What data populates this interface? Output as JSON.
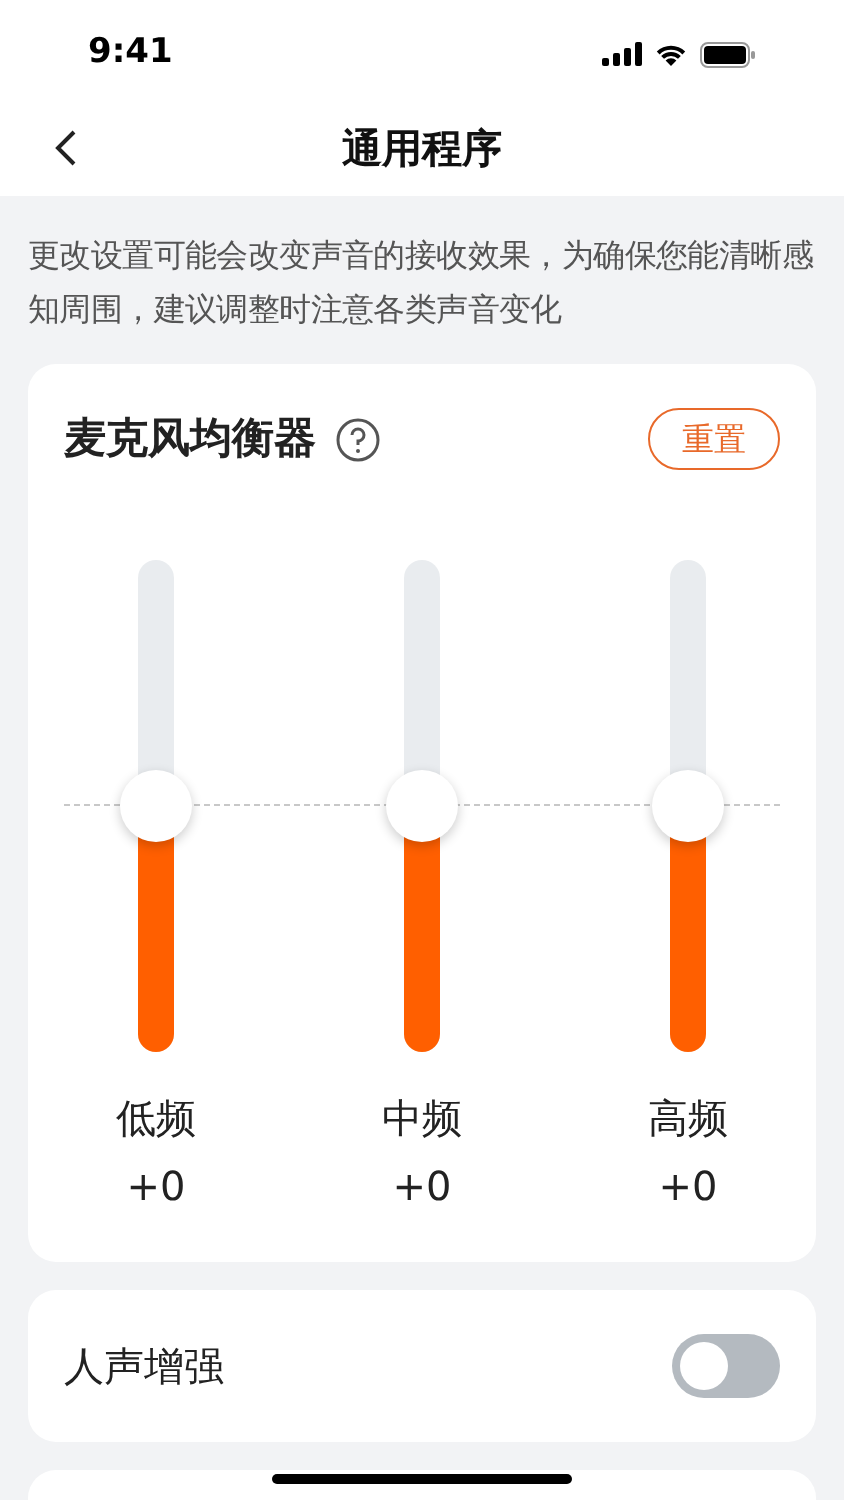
{
  "status_bar": {
    "time": "9:41"
  },
  "nav": {
    "title": "通用程序"
  },
  "notice": "更改设置可能会改变声音的接收效果，为确保您能清晰感知周围，建议调整时注意各类声音变化",
  "equalizer": {
    "title": "麦克风均衡器",
    "reset": "重置",
    "bands": [
      {
        "label": "低频",
        "reading": "+0",
        "level": 0.5
      },
      {
        "label": "中频",
        "reading": "+0",
        "level": 0.5
      },
      {
        "label": "高频",
        "reading": "+0",
        "level": 0.5
      }
    ]
  },
  "settings": [
    {
      "label": "人声增强",
      "on": false
    }
  ]
}
